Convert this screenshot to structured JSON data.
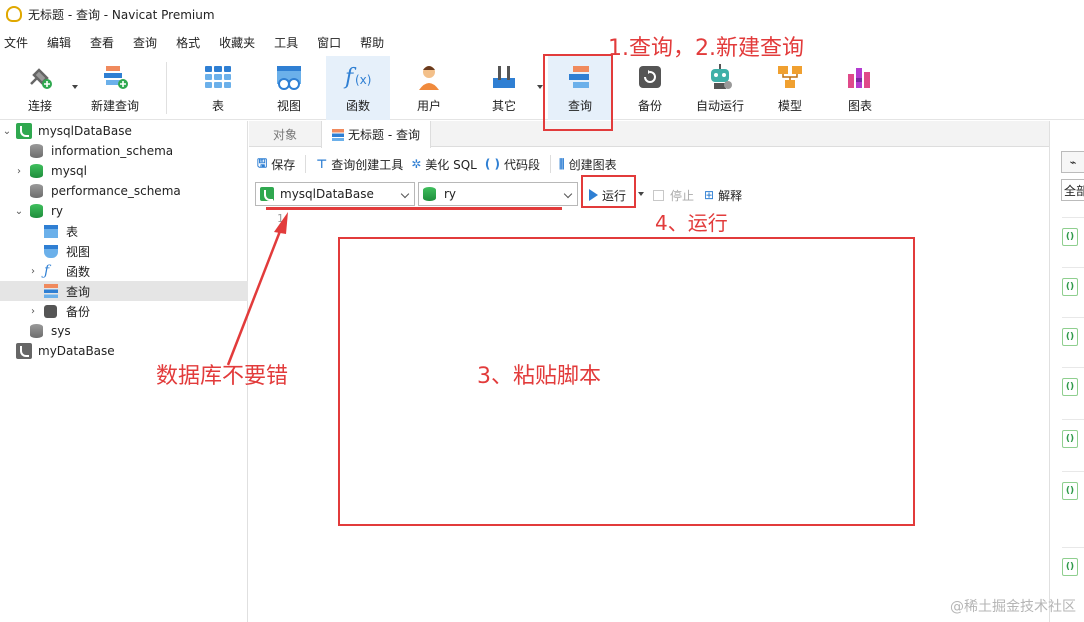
{
  "window": {
    "title": "无标题 - 查询 - Navicat Premium"
  },
  "menu": [
    "文件",
    "编辑",
    "查看",
    "查询",
    "格式",
    "收藏夹",
    "工具",
    "窗口",
    "帮助"
  ],
  "toolbar": {
    "connect": "连接",
    "new_query": "新建查询",
    "table": "表",
    "view": "视图",
    "function": "函数",
    "user": "用户",
    "other": "其它",
    "query": "查询",
    "backup": "备份",
    "auto_run": "自动运行",
    "model": "模型",
    "chart": "图表"
  },
  "tree": {
    "connection": "mysqlDataBase",
    "databases": [
      "information_schema",
      "mysql",
      "performance_schema",
      "ry"
    ],
    "ry_children": [
      "表",
      "视图",
      "函数",
      "查询",
      "备份"
    ],
    "sys": "sys",
    "second_connection": "myDataBase"
  },
  "tabs": {
    "objects": "对象",
    "query": "无标题 - 查询"
  },
  "query_toolbar": {
    "save": "保存",
    "builder": "查询创建工具",
    "beautify": "美化 SQL",
    "snippet": "代码段",
    "create_chart": "创建图表"
  },
  "selectors": {
    "connection": "mysqlDataBase",
    "database": "ry",
    "run": "运行",
    "stop": "停止",
    "explain": "解释"
  },
  "editor": {
    "line1": "1"
  },
  "right_panel": {
    "all": "全部"
  },
  "annotations": {
    "a1": "1.查询，2.新建查询",
    "a4": "4、运行",
    "a_db": "数据库不要错",
    "a3": "3、粘贴脚本"
  },
  "watermark": "@稀土掘金技术社区",
  "colors": {
    "annotation_red": "#e23b3b",
    "accent_blue": "#2f7fd3",
    "db_green": "#2fa84f"
  }
}
